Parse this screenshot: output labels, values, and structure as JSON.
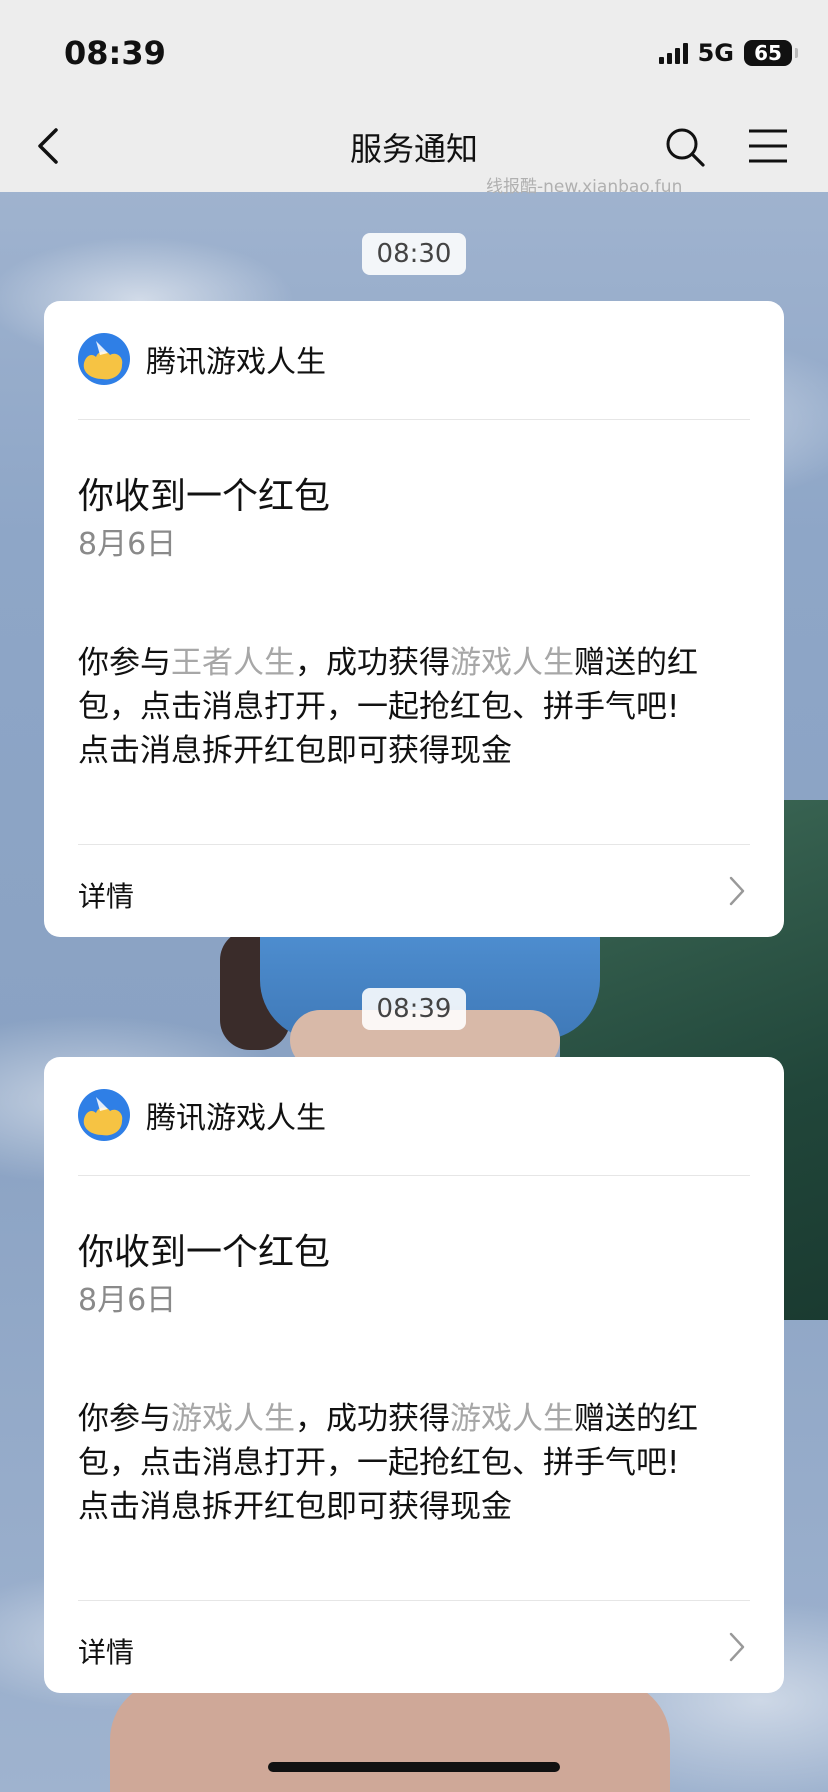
{
  "status_bar": {
    "time": "08:39",
    "network": "5G",
    "battery": "65"
  },
  "header": {
    "title": "服务通知",
    "back_icon": "chevron-left-icon",
    "search_icon": "search-icon",
    "menu_icon": "menu-icon",
    "watermark": "线报酷-new.xianbao.fun"
  },
  "messages": [
    {
      "time": "08:30",
      "app_name": "腾讯游戏人生",
      "title": "你收到一个红包",
      "date": "8月6日",
      "body_prefix": "你参与",
      "body_highlight_1": "王者人生",
      "body_mid": "，成功获得",
      "body_highlight_2": "游戏人生",
      "body_suffix": "赠送的红包，点击消息打开，一起抢红包、拼手气吧!",
      "body_line2": "点击消息拆开红包即可获得现金",
      "detail_label": "详情"
    },
    {
      "time": "08:39",
      "app_name": "腾讯游戏人生",
      "title": "你收到一个红包",
      "date": "8月6日",
      "body_prefix": "你参与",
      "body_highlight_1": "游戏人生",
      "body_mid": "，成功获得",
      "body_highlight_2": "游戏人生",
      "body_suffix": "赠送的红包，点击消息打开，一起抢红包、拼手气吧!",
      "body_line2": "点击消息拆开红包即可获得现金",
      "detail_label": "详情"
    }
  ],
  "colors": {
    "highlight_text": "#a7a7a7",
    "logo_blue": "#2f7fe6",
    "logo_yellow": "#f6c343"
  }
}
